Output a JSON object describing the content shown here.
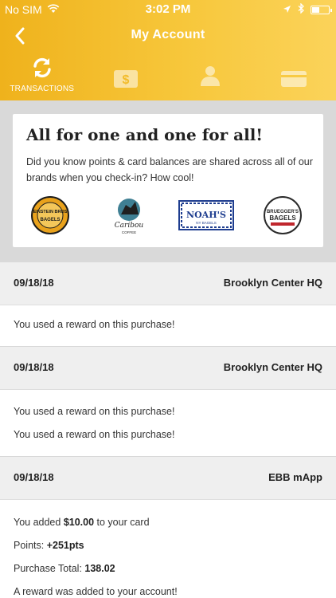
{
  "status": {
    "carrier": "No SIM",
    "time": "3:02 PM"
  },
  "header": {
    "title": "My Account"
  },
  "tabs": [
    {
      "label": "TRANSACTIONS",
      "icon": "refresh-icon",
      "active": true
    },
    {
      "label": "",
      "icon": "dollar-icon",
      "active": false
    },
    {
      "label": "",
      "icon": "person-icon",
      "active": false
    },
    {
      "label": "",
      "icon": "card-icon",
      "active": false
    }
  ],
  "promo": {
    "title": "All for one and one for all!",
    "text": "Did you know points & card balances are shared across all of our brands when you check-in? How cool!",
    "logos": [
      {
        "name": "einstein-bros-logo",
        "lines": [
          "EINSTEIN BROS",
          "BAGELS"
        ]
      },
      {
        "name": "caribou-coffee-logo",
        "lines": [
          "Caribou",
          "COFFEE"
        ]
      },
      {
        "name": "noahs-logo",
        "lines": [
          "NOAH'S",
          "NY BAGELS"
        ]
      },
      {
        "name": "brueggers-logo",
        "lines": [
          "BRUEGGER'S",
          "BAGELS"
        ]
      }
    ]
  },
  "transactions": [
    {
      "date": "09/18/18",
      "store": "Brooklyn Center HQ",
      "lines": [
        "You used a reward on this purchase!"
      ]
    },
    {
      "date": "09/18/18",
      "store": "Brooklyn Center HQ",
      "lines": [
        "You used a reward on this purchase!",
        "You used a reward on this purchase!"
      ]
    },
    {
      "date": "09/18/18",
      "store": "EBB mApp",
      "added_prefix": "You added ",
      "added_amount": "$10.00",
      "added_suffix": " to your card",
      "points_label": "Points: ",
      "points_value": "+251pts",
      "total_label": "Purchase Total: ",
      "total_value": "138.02",
      "reward_note": "A reward was added to your account!"
    }
  ],
  "colors": {
    "accent": "#f2b824",
    "row_bg": "#efefef",
    "promo_bg": "#d9d9d9"
  }
}
